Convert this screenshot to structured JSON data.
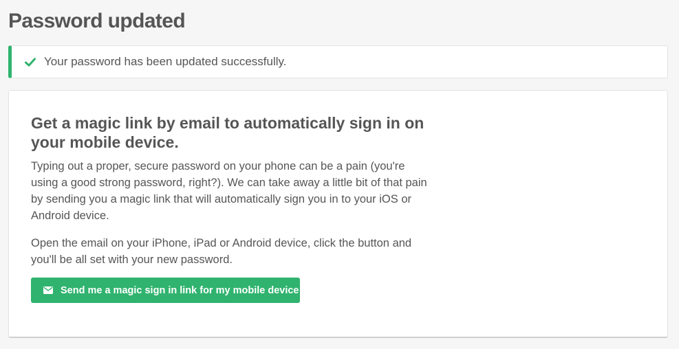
{
  "page": {
    "title": "Password updated"
  },
  "alert": {
    "icon": "check-icon",
    "message": "Your password has been updated successfully.",
    "color": "#2fb36e"
  },
  "card": {
    "title": "Get a magic link by email to automatically sign in on your mobile device.",
    "paragraph1": "Typing out a proper, secure password on your phone can be a pain (you're using a good strong password, right?). We can take away a little bit of that pain by sending you a magic link that will automatically sign you in to your iOS or Android device.",
    "paragraph2": "Open the email on your iPhone, iPad or Android device, click the button and you'll be all set with your new password.",
    "button": {
      "icon": "envelope-icon",
      "label": "Send me a magic sign in link for my mobile device",
      "color": "#2fb36e"
    }
  }
}
